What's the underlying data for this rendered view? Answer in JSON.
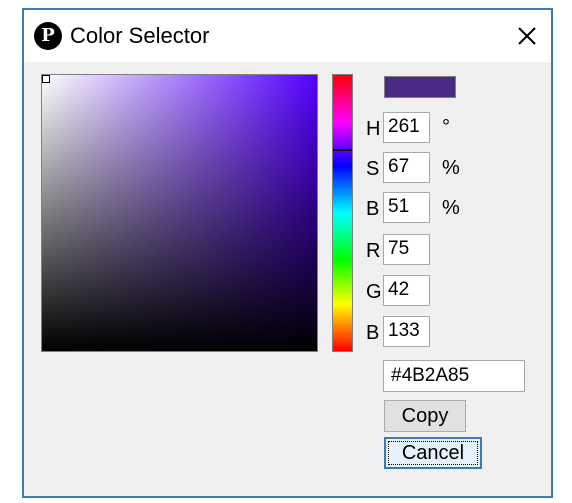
{
  "window": {
    "title": "Color Selector",
    "app_icon_glyph": "P",
    "close_icon": "close-icon"
  },
  "color": {
    "current_hex_value": "#4B2A85",
    "swatch_color": "#4b2a85",
    "hue_base_color": "#5500ff"
  },
  "fields": {
    "h": {
      "label": "H",
      "value": "261",
      "unit": "°"
    },
    "s": {
      "label": "S",
      "value": "67",
      "unit": "%"
    },
    "b_hsb": {
      "label": "B",
      "value": "51",
      "unit": "%"
    },
    "r": {
      "label": "R",
      "value": "75"
    },
    "g": {
      "label": "G",
      "value": "42"
    },
    "b_rgb": {
      "label": "B",
      "value": "133"
    }
  },
  "buttons": {
    "copy_label": "Copy",
    "cancel_label": "Cancel"
  }
}
